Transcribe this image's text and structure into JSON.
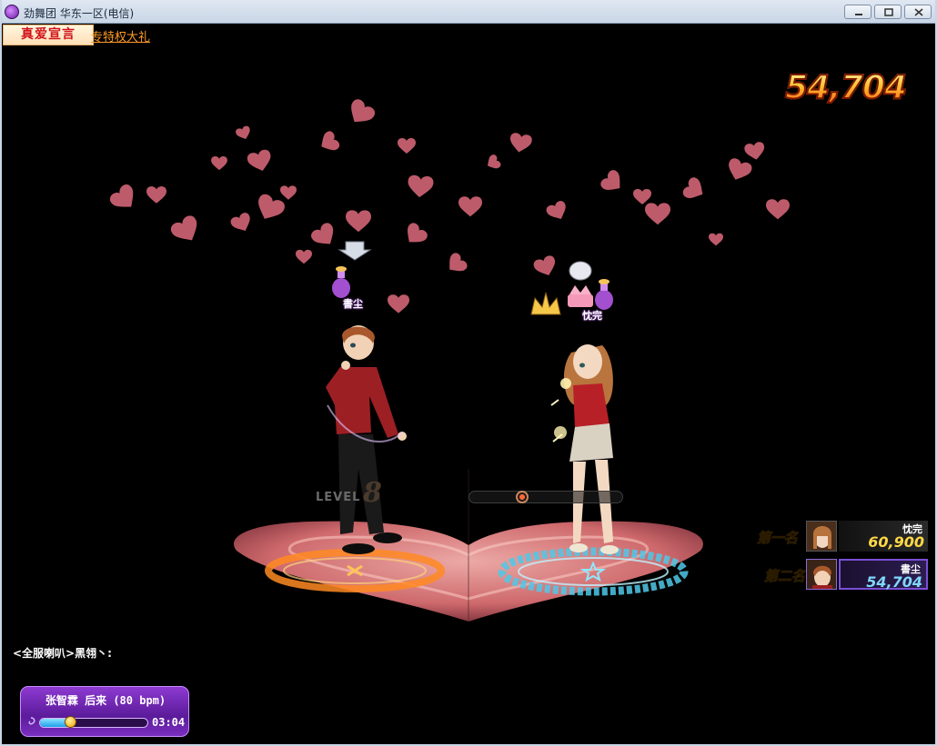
{
  "window": {
    "title": "劲舞团 华东一区(电信)",
    "controls": [
      "minimize",
      "maximize",
      "close"
    ]
  },
  "promo": {
    "badge": "真爱宣言",
    "link": "专特权大礼"
  },
  "score": {
    "total": "54,704"
  },
  "players": [
    {
      "name": "書尘",
      "role": "male-dancer",
      "icons": [
        "potion-icon"
      ]
    },
    {
      "name": "忱完",
      "role": "female-dancer",
      "icons": [
        "crown-icon",
        "tiara-icon",
        "potion-icon"
      ]
    }
  ],
  "level": {
    "label": "LEVEL",
    "value": "8"
  },
  "beat_meter": {
    "progress": 0.33
  },
  "ranking": [
    {
      "rank_label": "第一名",
      "name": "忱完",
      "score": "60,900"
    },
    {
      "rank_label": "第二名",
      "name": "書尘",
      "score": "54,704"
    }
  ],
  "chat": {
    "line": "<全服喇叭>黑翎丶:"
  },
  "song": {
    "title": "张智霖 后来 (80 bpm)",
    "time": "03:04",
    "progress": 0.28
  },
  "colors": {
    "hearts": "#d9707a",
    "stage_heart": "#f3a0a2",
    "rank1_score": "#ffd846",
    "rank2_score": "#7fd8ff",
    "song_panel": "#6a27ad"
  }
}
